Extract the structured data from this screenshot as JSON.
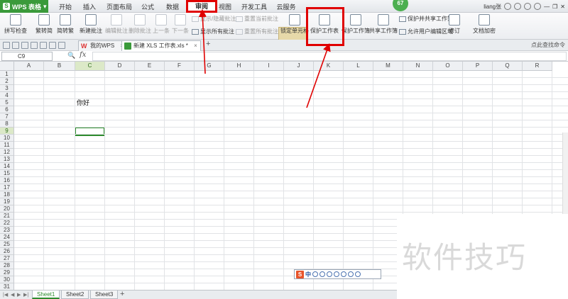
{
  "app": {
    "logo_label": "WPS 表格"
  },
  "menu": {
    "tabs": [
      "开始",
      "插入",
      "页面布局",
      "公式",
      "数据",
      "审阅",
      "视图",
      "开发工具",
      "云服务"
    ],
    "active": "审阅"
  },
  "user": {
    "badge": "67",
    "name": "liang张"
  },
  "ribbon": {
    "spellcheck": "拼写检查",
    "trad_to_simp": "繁转简",
    "simp_to_trad": "简转繁",
    "new_comment": "新建批注",
    "edit_comment": "编辑批注",
    "delete_comment": "删除批注",
    "prev": "上一条",
    "next": "下一条",
    "show_hide_comment": "显示/隐藏批注",
    "reset_current_comment": "重置当前批注",
    "show_all_comments": "显示所有批注",
    "reset_all_comments": "重置所有批注",
    "lock_cell": "锁定单元格",
    "protect_sheet": "保护工作表",
    "protect_workbook": "保护工作簿",
    "share_workbook": "共享工作簿",
    "protect_and_share": "保护并共享工作簿",
    "allow_edit_ranges": "允许用户编辑区域",
    "track_changes": "修订",
    "doc_encrypt": "文档加密"
  },
  "files": {
    "tab1": "我的WPS",
    "tab2": "新建 XLS 工作表.xls *",
    "search_hint": "点此查找命令"
  },
  "formula": {
    "name_box": "C9",
    "fx": "fx",
    "value": ""
  },
  "grid": {
    "columns": [
      "A",
      "B",
      "C",
      "D",
      "E",
      "F",
      "G",
      "H",
      "I",
      "J",
      "K",
      "L",
      "M",
      "N",
      "O",
      "P",
      "Q",
      "R"
    ],
    "rows": [
      "1",
      "2",
      "3",
      "4",
      "5",
      "6",
      "7",
      "8",
      "9",
      "10",
      "11",
      "12",
      "13",
      "14",
      "15",
      "16",
      "17",
      "18",
      "19",
      "20",
      "21",
      "22",
      "23",
      "24",
      "25",
      "26",
      "27",
      "28",
      "29",
      "30",
      "31",
      "32"
    ],
    "selected_col": "C",
    "selected_row": "9",
    "cell_c5": "你好"
  },
  "sheets": {
    "names": [
      "Sheet1",
      "Sheet2",
      "Sheet3"
    ],
    "active": "Sheet1"
  },
  "ime": {
    "mode": "中"
  },
  "watermark": "软件技巧",
  "colors": {
    "accent_green": "#3a9a3a",
    "annotation_red": "#e00000"
  }
}
